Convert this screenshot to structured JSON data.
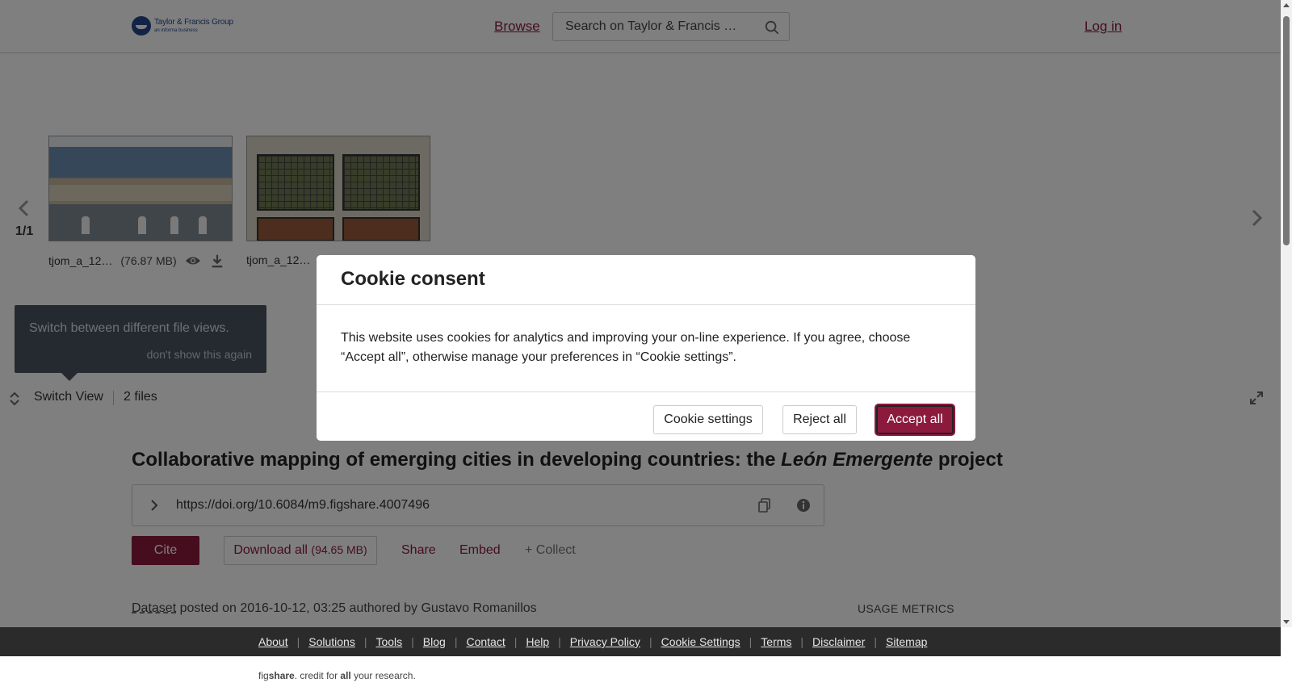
{
  "header": {
    "logo_name": "Taylor & Francis Group",
    "logo_sub": "an informa business",
    "browse_label": "Browse",
    "search_placeholder": "Search on Taylor & Francis …",
    "login_label": "Log in"
  },
  "carousel": {
    "page_indicator": "1/1",
    "files": [
      {
        "name": "tjom_a_1230524_f0001_oc.jpg",
        "display_name": "tjom_a_12…",
        "size": "(76.87 MB)"
      },
      {
        "name": "tjom_a_1230524_f0002_oc.jpg",
        "display_name": "tjom_a_12…"
      }
    ]
  },
  "tooltip": {
    "text": "Switch between different file views.",
    "dismiss": "don't show this again"
  },
  "viewbar": {
    "switch_label": "Switch View",
    "files_count": "2 files"
  },
  "article": {
    "title_prefix": "Collaborative mapping of emerging cities in developing countries: the ",
    "title_em": "León Emergente",
    "title_suffix": " project",
    "doi": "https://doi.org/10.6084/m9.figshare.4007496",
    "cite_label": "Cite",
    "download_label": "Download all",
    "download_size": "(94.65 MB)",
    "share_label": "Share",
    "embed_label": "Embed",
    "collect_label": "+ Collect",
    "meta_type": "Dataset",
    "meta_text": " posted on 2016-10-12, 03:25 authored by Gustavo Romanillos",
    "usage_label": "USAGE METRICS"
  },
  "footer": {
    "links": [
      "About",
      "Solutions",
      "Tools",
      "Blog",
      "Contact",
      "Help",
      "Privacy Policy",
      "Cookie Settings",
      "Terms",
      "Disclaimer",
      "Sitemap"
    ],
    "tagline_parts": [
      "fig",
      "share",
      ". credit for ",
      "all",
      " your research."
    ]
  },
  "cookie_modal": {
    "title": "Cookie consent",
    "body": "This website uses cookies for analytics and improving your on-line experience. If you agree, choose “Accept all”, otherwise manage your preferences in “Cookie settings”.",
    "settings_label": "Cookie settings",
    "reject_label": "Reject all",
    "accept_label": "Accept all"
  },
  "colors": {
    "brand": "#8b1a3d",
    "logo_blue": "#24488c",
    "footer_bg": "#2b2b2b",
    "tooltip_bg": "#4a5460"
  }
}
